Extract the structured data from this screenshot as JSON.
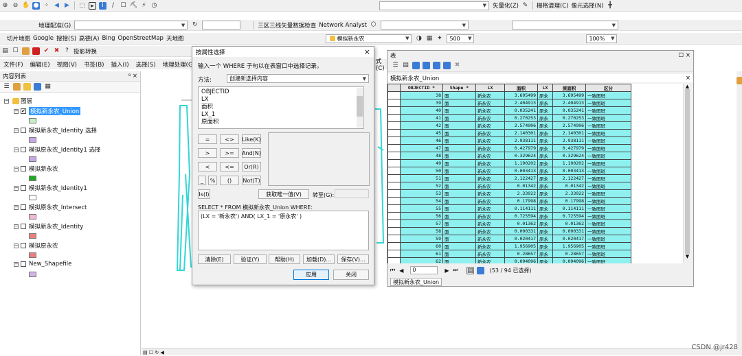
{
  "toolbar1": {
    "vector_label": "矢量化(Z)",
    "raster_clean": "栅格清理(C)",
    "cell_select": "像元选择(N)"
  },
  "toolbar2": {
    "georef": "地理配准(G)",
    "mapview_label": "三区三线矢量数据检查",
    "network": "Network Analyst"
  },
  "toolbar3": {
    "slice": "切片地图",
    "google": "Google",
    "search": "搜搜(S)",
    "gaode": "高德(A)",
    "bing": "Bing",
    "osm": "OpenStreetMap",
    "tianditu": "天地图",
    "layer_combo": "模拟新永农",
    "scale": "500",
    "zoom": "100%"
  },
  "toolbar4": {
    "projection": "投影转换"
  },
  "menu": [
    "文件(F)",
    "编辑(E)",
    "视图(V)",
    "书签(B)",
    "插入(I)",
    "选择(S)",
    "地理处理(G)"
  ],
  "menu_suffix": "式(C)",
  "toc": {
    "title": "内容列表",
    "pin": "ᵍ ×",
    "root": "图层",
    "layers": [
      {
        "name": "模拟新永农_Union",
        "checked": true,
        "selected": true,
        "swatch": "#c6f0c6"
      },
      {
        "name": "模拟新永农_Identity 选择",
        "checked": false,
        "swatch": "#c7a8e6"
      },
      {
        "name": "模拟原永农_Identity1 选择",
        "checked": false,
        "swatch": "#c7a8e6"
      },
      {
        "name": "模拟新永农",
        "checked": false,
        "swatch": "#22aa22"
      },
      {
        "name": "模拟新永农_Identity1",
        "checked": false,
        "swatch": "#ffffff"
      },
      {
        "name": "模拟原永农_Intersect",
        "checked": false,
        "swatch": "#f2b8d8"
      },
      {
        "name": "模拟新永农_Identity",
        "checked": false,
        "swatch": "#e88080"
      },
      {
        "name": "模拟原永农",
        "checked": false,
        "swatch": "#e88080"
      },
      {
        "name": "New_Shapefile",
        "checked": false,
        "swatch": "#d2b4e8"
      }
    ]
  },
  "dialog": {
    "title": "按属性选择",
    "close": "×",
    "hint": "输入一个 WHERE 子句以在表窗口中选择记录。",
    "method_label": "方法:",
    "method_value": "创建新选择内容",
    "fields": [
      "OBJECTID",
      "LX",
      "面积",
      "LX_1",
      "原面积"
    ],
    "ops": [
      "=",
      "<>",
      "Like(K)",
      ">",
      ">=",
      "And(N)",
      "<",
      "<=",
      "Or(R)",
      "_",
      "%",
      "()",
      "Not(T)",
      "Is(I)"
    ],
    "unique_btn": "获取唯一值(V)",
    "goto_label": "转至(G):",
    "select_from": "SELECT * FROM 模拟新永农_Union WHERE:",
    "where": "(LX = '新永农') AND( LX_1 = '原永农' )",
    "clear": "清除(E)",
    "verify": "验证(Y)",
    "help": "帮助(H)",
    "load": "加载(D)...",
    "save": "保存(V)...",
    "apply": "应用",
    "close_btn": "关闭"
  },
  "table": {
    "title": "表",
    "close": "×",
    "layer_name": "模拟新永农_Union",
    "columns": [
      "OBJECTID *",
      "Shape *",
      "LX",
      "面积",
      "LX",
      "原面积",
      "区分"
    ],
    "rows": [
      [
        "38",
        "面",
        "新永农",
        "3.695499",
        "原永",
        "3.695499",
        "一致图斑"
      ],
      [
        "39",
        "面",
        "新永农",
        "2.404913",
        "原永",
        "2.404913",
        "一致图斑"
      ],
      [
        "40",
        "面",
        "新永农",
        "0.035241",
        "原永",
        "0.035241",
        "一致图斑"
      ],
      [
        "41",
        "面",
        "新永农",
        "0.270253",
        "原永",
        "0.270253",
        "一致图斑"
      ],
      [
        "42",
        "面",
        "新永农",
        "2.574906",
        "原永",
        "2.574906",
        "一致图斑"
      ],
      [
        "45",
        "面",
        "新永农",
        "2.140301",
        "原永",
        "2.140301",
        "一致图斑"
      ],
      [
        "46",
        "面",
        "新永农",
        "2.938111",
        "原永",
        "2.938111",
        "一致图斑"
      ],
      [
        "47",
        "面",
        "新永农",
        "0.427979",
        "原永",
        "0.427979",
        "一致图斑"
      ],
      [
        "48",
        "面",
        "新永农",
        "0.329624",
        "原永",
        "0.329624",
        "一致图斑"
      ],
      [
        "49",
        "面",
        "新永农",
        "1.190202",
        "原永",
        "1.190202",
        "一致图斑"
      ],
      [
        "50",
        "面",
        "新永农",
        "0.003413",
        "原永",
        "0.003413",
        "一致图斑"
      ],
      [
        "51",
        "面",
        "新永农",
        "2.122427",
        "原永",
        "2.122427",
        "一致图斑"
      ],
      [
        "52",
        "面",
        "新永农",
        "0.01342",
        "原永",
        "0.01342",
        "一致图斑"
      ],
      [
        "53",
        "面",
        "新永农",
        "2.33922",
        "原永",
        "2.33922",
        "一致图斑"
      ],
      [
        "54",
        "面",
        "新永农",
        "0.17998",
        "原永",
        "0.17998",
        "一致图斑"
      ],
      [
        "55",
        "面",
        "新永农",
        "0.114111",
        "原永",
        "0.114111",
        "一致图斑"
      ],
      [
        "56",
        "面",
        "新永农",
        "0.725594",
        "原永",
        "0.725594",
        "一致图斑"
      ],
      [
        "57",
        "面",
        "新永农",
        "0.01362",
        "原永",
        "0.01362",
        "一致图斑"
      ],
      [
        "58",
        "面",
        "新永农",
        "0.000331",
        "原永",
        "0.000331",
        "一致图斑"
      ],
      [
        "59",
        "面",
        "新永农",
        "0.020417",
        "原永",
        "0.020417",
        "一致图斑"
      ],
      [
        "60",
        "面",
        "新永农",
        "1.956905",
        "原永",
        "1.956905",
        "一致图斑"
      ],
      [
        "61",
        "面",
        "新永农",
        "0.28657",
        "原永",
        "0.28657",
        "一致图斑"
      ],
      [
        "62",
        "面",
        "新永农",
        "0.094096",
        "原永",
        "0.094096",
        "一致图斑"
      ]
    ],
    "nav_page": "0",
    "status": "(53 / 94 已选择)",
    "tab": "模拟新永农_Union"
  },
  "watermark": "CSDN @jr428"
}
